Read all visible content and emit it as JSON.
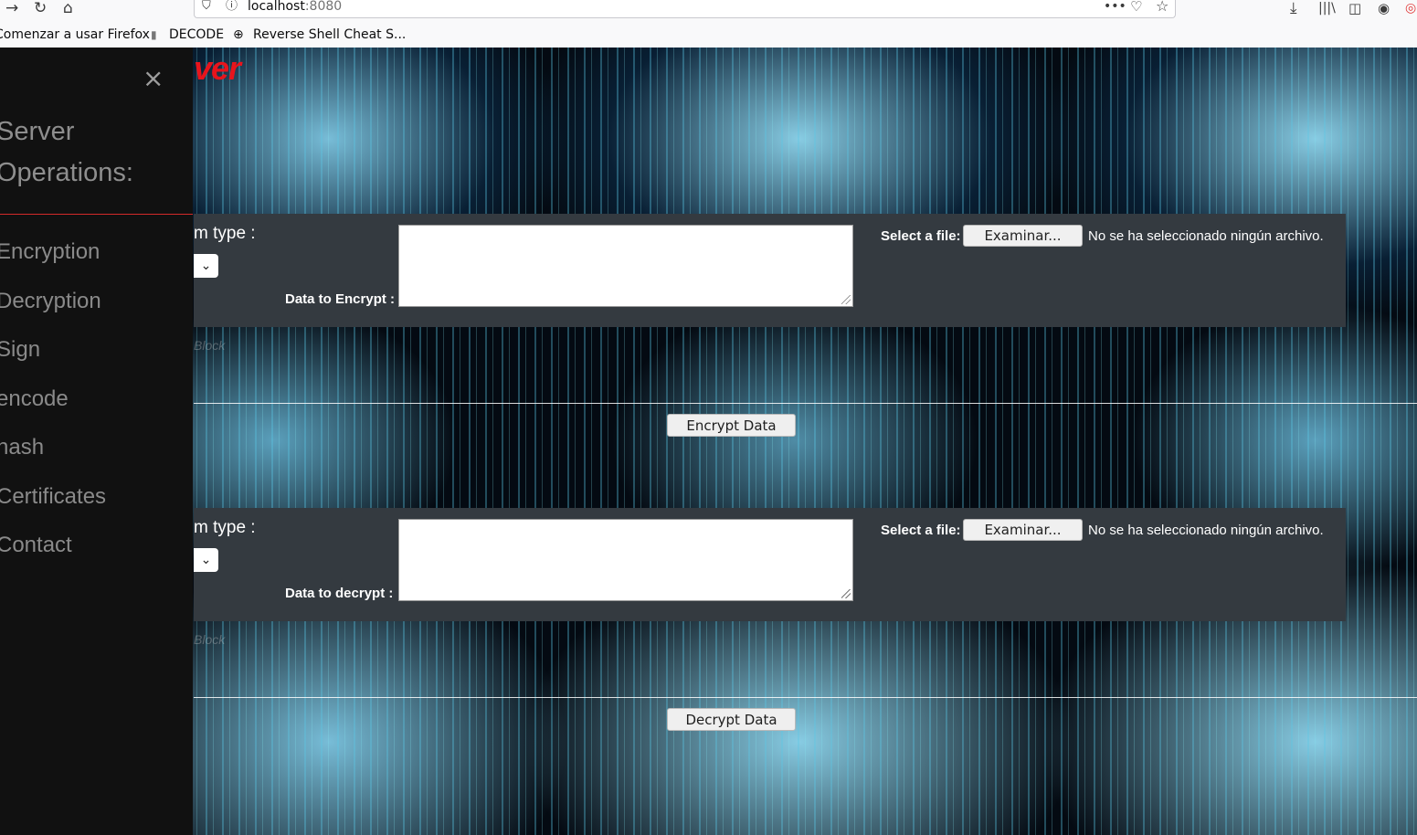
{
  "browser": {
    "url_host": "localhost",
    "url_port": ":8080",
    "bookmarks": [
      "Comenzar a usar Firefox",
      "DECODE",
      "Reverse Shell Cheat S..."
    ]
  },
  "page": {
    "logo_text": "ver"
  },
  "sidebar": {
    "close_glyph": "×",
    "title_line1": "Server",
    "title_line2": "Operations:",
    "items": [
      {
        "label": "Encryption"
      },
      {
        "label": "Decryption"
      },
      {
        "label": "Sign"
      },
      {
        "label": "encode"
      },
      {
        "label": "hash"
      },
      {
        "label": "Certificates"
      },
      {
        "label": "Contact"
      }
    ]
  },
  "encrypt": {
    "algo_label": "m type :",
    "data_label": "Data to Encrypt :",
    "textarea_value": "",
    "file_label": "Select a file:",
    "file_button": "Examinar...",
    "file_status": "No se ha seleccionado ningún archivo.",
    "ghost_text": "Block",
    "action_button": "Encrypt Data"
  },
  "decrypt": {
    "algo_label": "m type :",
    "data_label": "Data to decrypt :",
    "textarea_value": "",
    "file_label": "Select a file:",
    "file_button": "Examinar...",
    "file_status": "No se ha seleccionado ningún archivo.",
    "ghost_text": "Block",
    "action_button": "Decrypt Data"
  }
}
